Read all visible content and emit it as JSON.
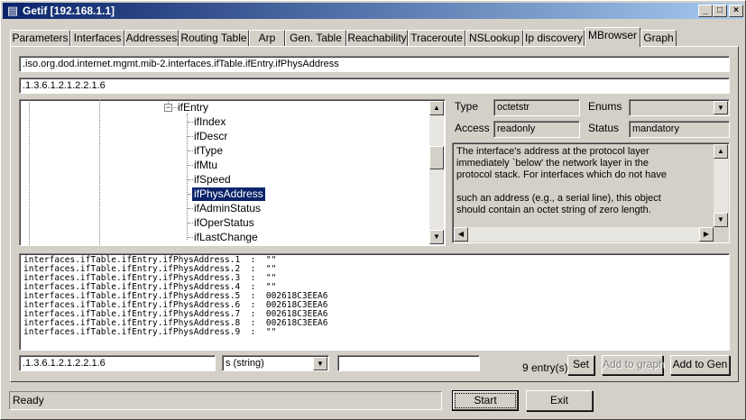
{
  "window": {
    "title": "Getif [192.168.1.1]",
    "icon": "app-document-icon"
  },
  "title_buttons": {
    "minimize": "_",
    "maximize": "□",
    "close": "×"
  },
  "tabs": [
    {
      "label": "Parameters"
    },
    {
      "label": "Interfaces"
    },
    {
      "label": "Addresses"
    },
    {
      "label": "Routing Table"
    },
    {
      "label": "Arp"
    },
    {
      "label": "Gen. Table"
    },
    {
      "label": "Reachability"
    },
    {
      "label": "Traceroute"
    },
    {
      "label": "NSLookup"
    },
    {
      "label": "Ip discovery"
    },
    {
      "label": "MBrowser"
    },
    {
      "label": "Graph"
    }
  ],
  "active_tab": "MBrowser",
  "oid_path": ".iso.org.dod.internet.mgmt.mib-2.interfaces.ifTable.ifEntry.ifPhysAddress",
  "oid_numeric": ".1.3.6.1.2.1.2.2.1.6",
  "tree": {
    "parent": "ifEntry",
    "expander": "−",
    "children": [
      "ifIndex",
      "ifDescr",
      "ifType",
      "ifMtu",
      "ifSpeed",
      "ifPhysAddress",
      "ifAdminStatus",
      "ifOperStatus",
      "ifLastChange"
    ],
    "selected": "ifPhysAddress"
  },
  "props": {
    "type_label": "Type",
    "type_value": "octetstr",
    "enums_label": "Enums",
    "enums_value": "",
    "access_label": "Access",
    "access_value": "readonly",
    "status_label": "Status",
    "status_value": "mandatory"
  },
  "description": [
    "The interface's address at the protocol layer",
    "immediately `below' the network layer in the",
    "protocol stack. For interfaces which do not have",
    "",
    "such an address (e.g., a serial line), this object",
    "should contain an octet string of zero length."
  ],
  "results": [
    {
      "oid": "interfaces.ifTable.ifEntry.ifPhysAddress.1",
      "value": "\"\""
    },
    {
      "oid": "interfaces.ifTable.ifEntry.ifPhysAddress.2",
      "value": "\"\""
    },
    {
      "oid": "interfaces.ifTable.ifEntry.ifPhysAddress.3",
      "value": "\"\""
    },
    {
      "oid": "interfaces.ifTable.ifEntry.ifPhysAddress.4",
      "value": "\"\""
    },
    {
      "oid": "interfaces.ifTable.ifEntry.ifPhysAddress.5",
      "value": "002618C3EEA6"
    },
    {
      "oid": "interfaces.ifTable.ifEntry.ifPhysAddress.6",
      "value": "002618C3EEA6"
    },
    {
      "oid": "interfaces.ifTable.ifEntry.ifPhysAddress.7",
      "value": "002618C3EEA6"
    },
    {
      "oid": "interfaces.ifTable.ifEntry.ifPhysAddress.8",
      "value": "002618C3EEA6"
    },
    {
      "oid": "interfaces.ifTable.ifEntry.ifPhysAddress.9",
      "value": "\"\""
    }
  ],
  "result_separator": ":",
  "set_row": {
    "oid": ".1.3.6.1.2.1.2.2.1.6",
    "type": "s (string)",
    "value": "",
    "entry_count": "9 entry(s)",
    "set_label": "Set",
    "add_graph_label": "Add to graph",
    "add_gen_label": "Add to Gen"
  },
  "status": {
    "text": "Ready"
  },
  "footer": {
    "start_label": "Start",
    "exit_label": "Exit"
  },
  "icons": {
    "scroll_up": "▲",
    "scroll_down": "▼",
    "scroll_left": "◀",
    "scroll_right": "▶",
    "dropdown": "▼"
  }
}
